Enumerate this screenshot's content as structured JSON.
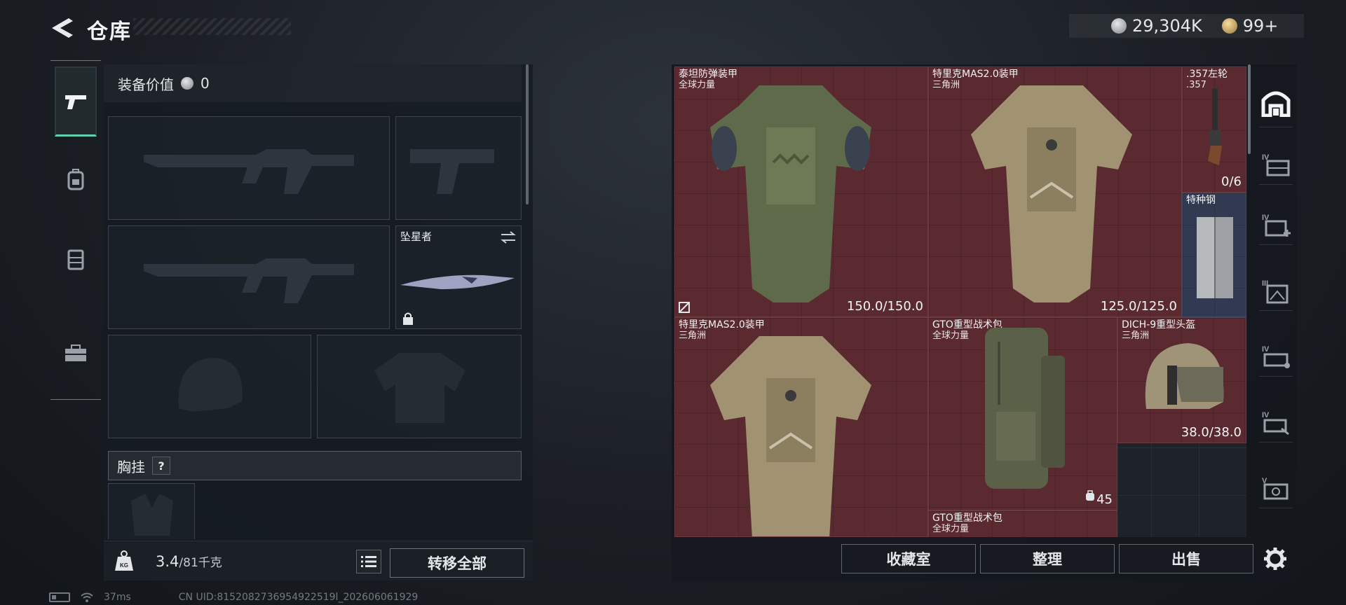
{
  "header": {
    "title": "仓库",
    "currency_main": "29,304K",
    "currency_premium": "99+"
  },
  "sidebar": {
    "tabs": [
      {
        "icon": "pistol-icon",
        "active": true
      },
      {
        "icon": "backpack-icon",
        "active": false
      },
      {
        "icon": "vest-icon",
        "active": false
      },
      {
        "icon": "toolbox-icon",
        "active": false
      }
    ]
  },
  "loadout": {
    "value_label": "装备价值",
    "value": "0",
    "melee_name": "坠星者",
    "chest_label": "胸挂",
    "chest_help": "?",
    "weight_current": "3.4",
    "weight_max": "/81千克",
    "kg_icon_text": "KG",
    "transfer_all": "转移全部"
  },
  "storage": {
    "items": [
      {
        "name": "泰坦防弹装甲",
        "sub": "全球力量",
        "durability": "150.0/150.0"
      },
      {
        "name": "特里克MAS2.0装甲",
        "sub": "三角洲",
        "durability": "125.0/125.0"
      },
      {
        "name": ".357左轮",
        "sub": ".357",
        "durability": "0/6"
      },
      {
        "name": "特种钢",
        "sub": "",
        "durability": ""
      },
      {
        "name": "特里克MAS2.0装甲",
        "sub": "三角洲",
        "durability": ""
      },
      {
        "name": "GTO重型战术包",
        "sub": "全球力量",
        "durability": "45"
      },
      {
        "name": "DICH-9重型头盔",
        "sub": "三角洲",
        "durability": "38.0/38.0"
      },
      {
        "name": "GTO重型战术包",
        "sub": "全球力量",
        "durability": ""
      }
    ],
    "right_tabs": [
      "IV",
      "IV",
      "III",
      "IV",
      "IV",
      "V"
    ],
    "buttons": {
      "vault": "收藏室",
      "sort": "整理",
      "sell": "出售"
    }
  },
  "status": {
    "ping": "37ms",
    "uid": "CN UID:8152082736954922519l_202606061929"
  }
}
